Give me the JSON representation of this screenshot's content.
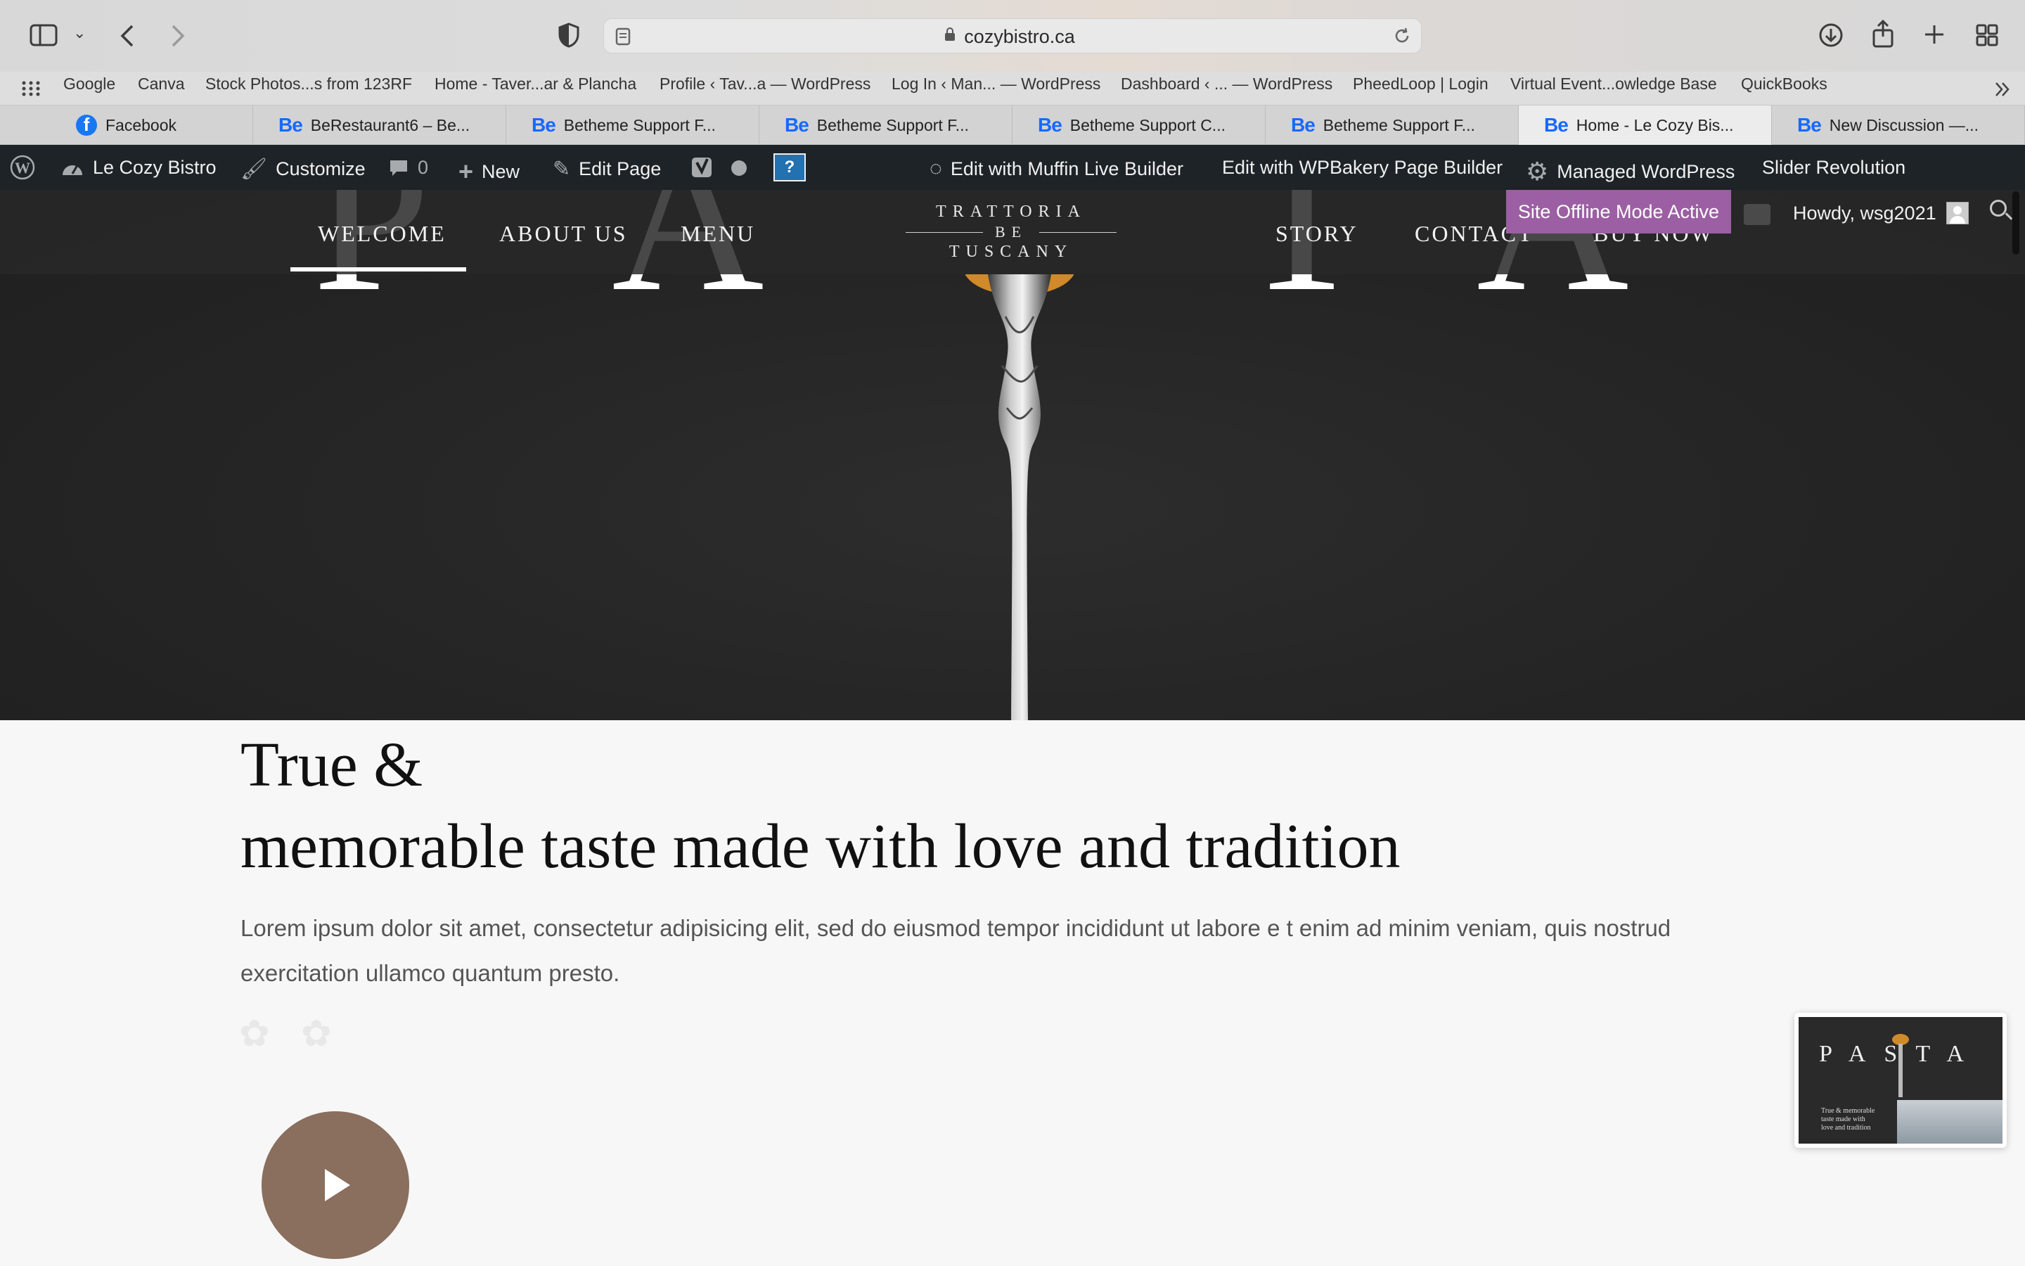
{
  "browser": {
    "url": "cozybistro.ca",
    "bookmarks": [
      "Google",
      "Canva",
      "Stock Photos...s from 123RF",
      "Home - Taver...ar & Plancha",
      "Profile ‹ Tav...a — WordPress",
      "Log In ‹ Man... — WordPress",
      "Dashboard ‹ ... — WordPress",
      "PheedLoop | Login",
      "Virtual Event...owledge Base",
      "QuickBooks"
    ],
    "tabs": [
      {
        "label": "Facebook",
        "icon": "facebook-icon"
      },
      {
        "label": "BeRestaurant6 – Be...",
        "icon": "behance-icon"
      },
      {
        "label": "Betheme Support F...",
        "icon": "behance-icon"
      },
      {
        "label": "Betheme Support F...",
        "icon": "behance-icon"
      },
      {
        "label": "Betheme Support C...",
        "icon": "behance-icon"
      },
      {
        "label": "Betheme Support F...",
        "icon": "behance-icon"
      },
      {
        "label": "Home - Le Cozy Bis...",
        "icon": "behance-icon",
        "active": true
      },
      {
        "label": "New Discussion —...",
        "icon": "behance-icon"
      }
    ]
  },
  "adminbar": {
    "site_name": "Le Cozy Bistro",
    "customize": "Customize",
    "comments_count": "0",
    "new": "New",
    "edit_page": "Edit Page",
    "muffin": "Edit with Muffin Live Builder",
    "wpbakery": "Edit with WPBakery Page Builder",
    "managed": "Managed WordPress",
    "slider": "Slider Revolution",
    "offline": "Site Offline Mode Active",
    "howdy": "Howdy, wsg2021"
  },
  "site": {
    "nav_left": [
      "WELCOME",
      "ABOUT US",
      "MENU"
    ],
    "nav_right": [
      "STORY",
      "CONTACT",
      "BUY NOW"
    ],
    "logo": {
      "line1": "TRATTORIA",
      "line2": "BE",
      "line3": "TUSCANY"
    },
    "hero_letters": [
      "P",
      "A",
      "T",
      "A"
    ]
  },
  "content": {
    "headline_line1": "True &",
    "headline_line2": "memorable taste made with love and tradition",
    "paragraph": "Lorem ipsum dolor sit amet, consectetur adipisicing elit, sed do eiusmod tempor incididunt ut labore e t enim ad minim veniam, quis nostrud exercitation ullamco quantum presto."
  },
  "thumbnail": {
    "letters": "PASTA",
    "text": "True & memorable taste made with love and tradition"
  },
  "colors": {
    "admin_bar": "#1d2327",
    "offline_badge": "#9c5fa3",
    "play_button": "#8a6e5e",
    "behance_blue": "#1769ff",
    "facebook_blue": "#1877f2"
  }
}
